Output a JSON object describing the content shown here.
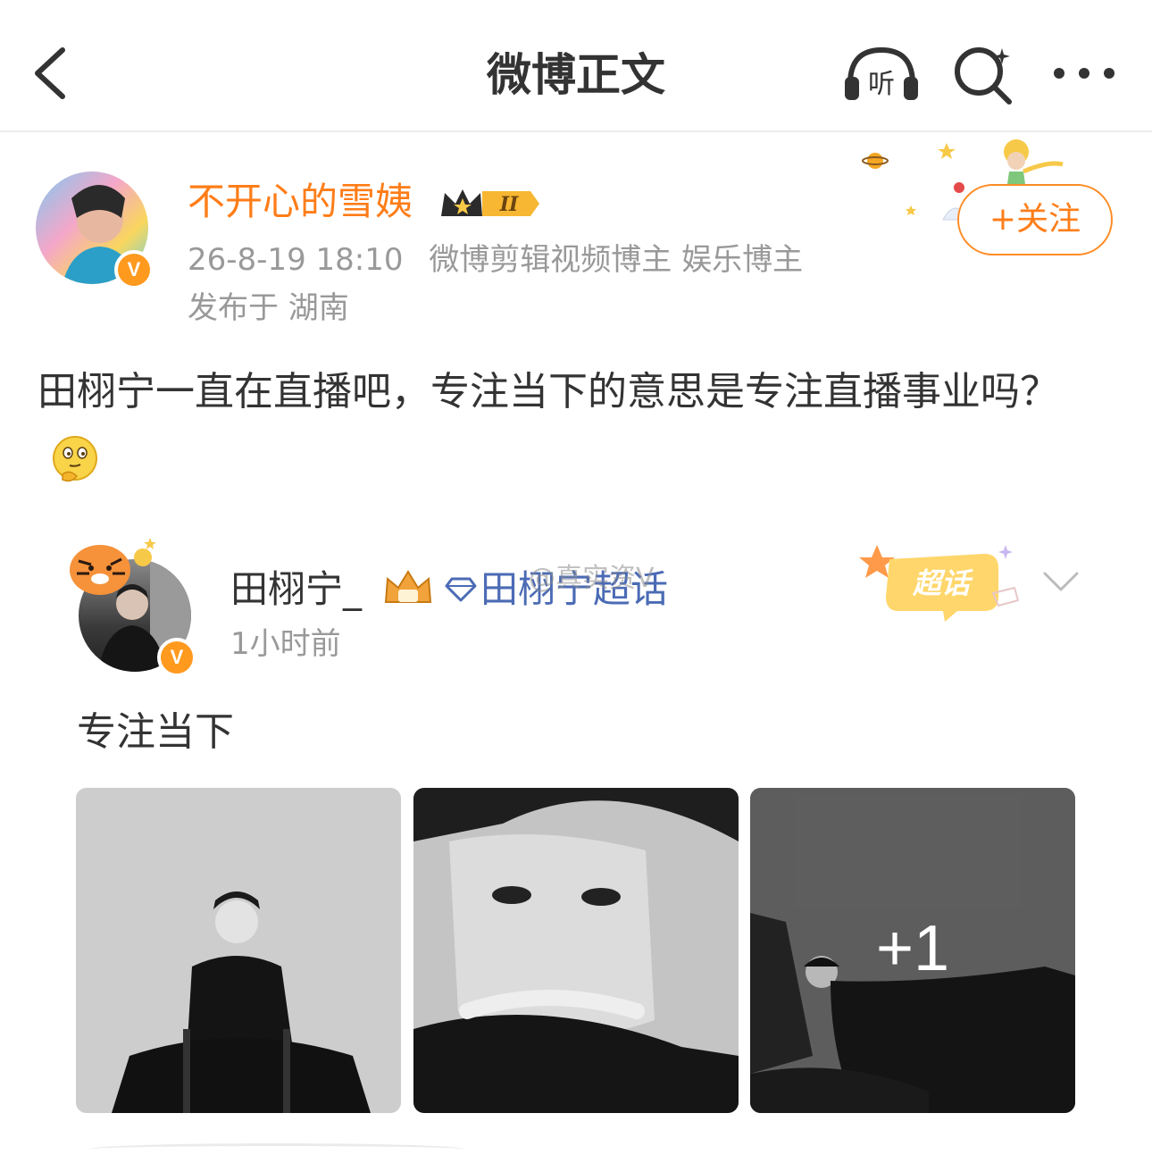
{
  "nav": {
    "title": "微博正文",
    "listen_label": "听"
  },
  "post": {
    "author": "不开心的雪姨",
    "verified_mark": "V",
    "member_level": "II",
    "timestamp": "26-8-19 18:10",
    "tags": "微博剪辑视频博主 娱乐博主",
    "location": "发布于 湖南",
    "follow_label": "+关注",
    "text": "田栩宁一直在直播吧，专注当下的意思是专注直播事业吗？"
  },
  "repost": {
    "author": "田栩宁_",
    "verified_mark": "V",
    "topic": "田栩宁超话",
    "watermark": "@真实资V",
    "badge": "超话",
    "time": "1小时前",
    "text": "专注当下",
    "more_images": "+1"
  },
  "icons": {
    "back": "chevron-left-icon",
    "listen": "headphones-icon",
    "search": "search-sparkle-icon",
    "more": "more-dots-icon",
    "emoji": "thinking-face-icon",
    "topic": "diamond-icon",
    "chevron": "chevron-down-icon"
  },
  "colors": {
    "accent": "#ff7d18",
    "link": "#4b6bb5",
    "muted": "#999999"
  }
}
